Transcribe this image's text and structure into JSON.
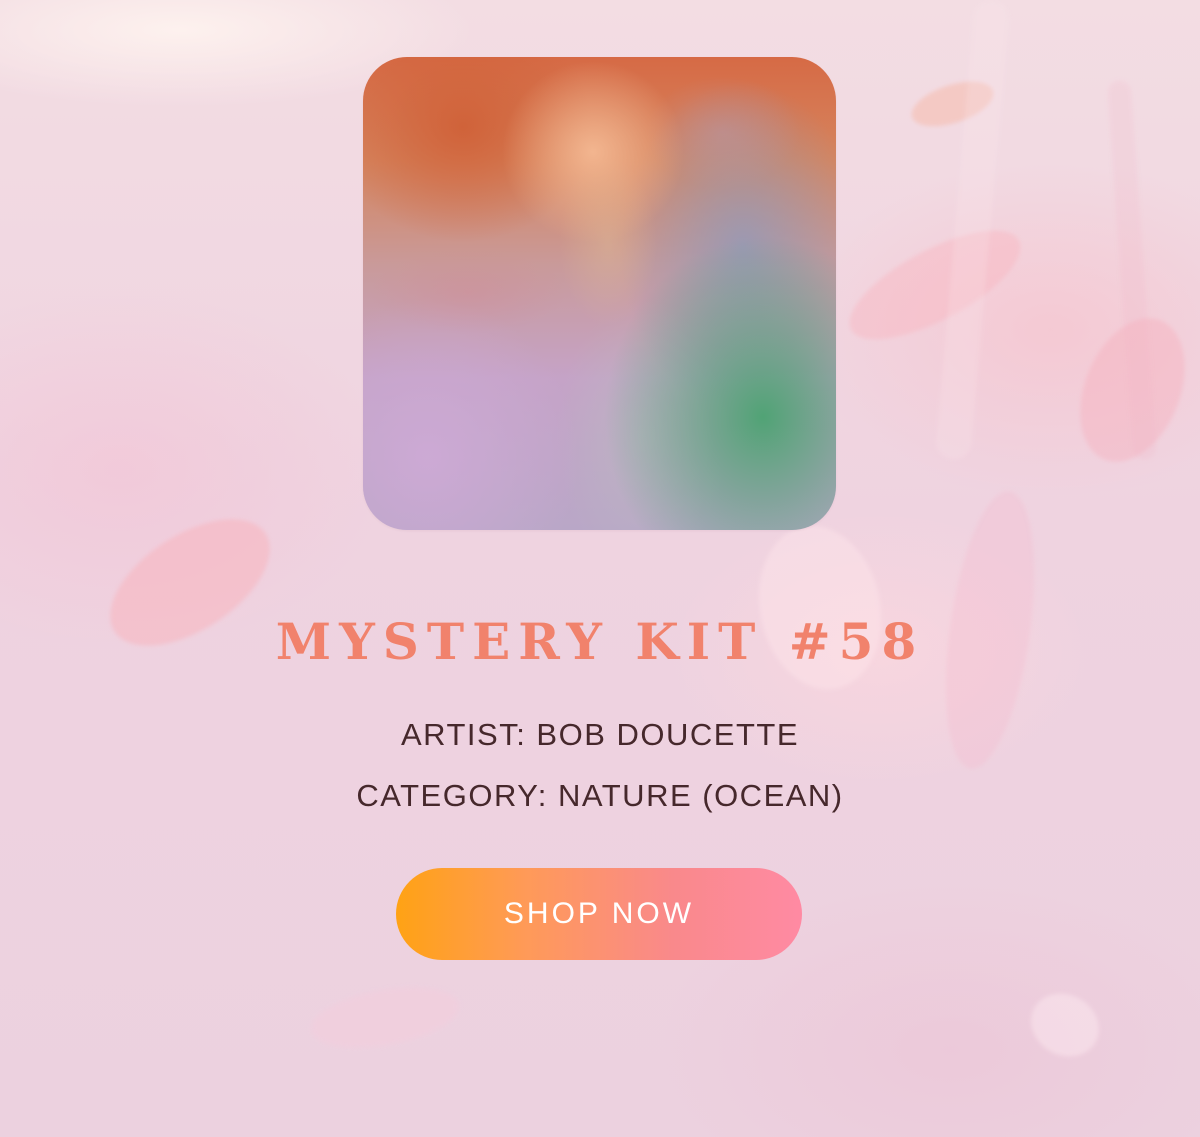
{
  "product": {
    "title": "MYSTERY KIT #58",
    "artist_line": "ARTIST: BOB DOUCETTE",
    "category_line": "CATEGORY: NATURE (OCEAN)",
    "cta_label": "SHOP NOW"
  },
  "colors": {
    "title": "#f1826c",
    "meta_text": "#46282c",
    "cta_gradient_start": "#ffa214",
    "cta_gradient_end": "#ff8aa3",
    "background": "#efd6e1"
  },
  "icons": {
    "art_image": "blurred-abstract-ocean-artwork"
  }
}
